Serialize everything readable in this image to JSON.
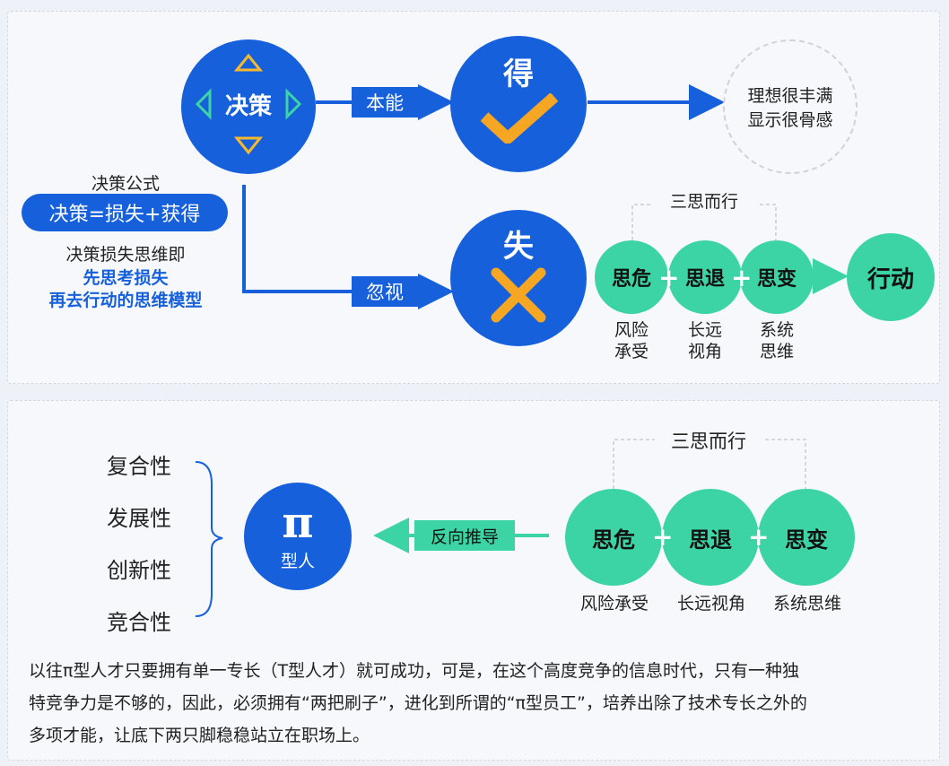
{
  "top": {
    "decision_label": "决策",
    "instinct_label": "本能",
    "gain_label": "得",
    "ideal_line1": "理想很丰满",
    "ideal_line2": "显示很骨感",
    "formula_title": "决策公式",
    "formula": "决策=损失+获得",
    "mindset_line": "决策损失思维即",
    "model_line1": "先思考损失",
    "model_line2": "再去行动的思维模型",
    "ignore_label": "忽视",
    "loss_label": "失",
    "think_thrice": "三思而行",
    "think_danger": "思危",
    "think_retreat": "思退",
    "think_change": "思变",
    "action": "行动",
    "sub_risk_1": "风险",
    "sub_risk_2": "承受",
    "sub_long_1": "长远",
    "sub_long_2": "视角",
    "sub_sys_1": "系统",
    "sub_sys_2": "思维"
  },
  "bottom": {
    "traits": [
      "复合性",
      "发展性",
      "创新性",
      "竞合性"
    ],
    "pi_symbol": "π",
    "pi_type": "型人",
    "reverse_label": "反向推导",
    "think_thrice": "三思而行",
    "think_danger": "思危",
    "think_retreat": "思退",
    "think_change": "思变",
    "sub_risk": "风险承受",
    "sub_long": "长远视角",
    "sub_sys": "系统思维",
    "paragraph_line1": "以往π型人才只要拥有单一专长（T型人才）就可成功，可是，在这个高度竞争的信息时代，只有一种独",
    "paragraph_line2": "特竞争力是不够的，因此，必须拥有“两把刷子”，进化到所谓的“π型员工”，培养出除了技术专长之外的",
    "paragraph_line3": "多项才能，让底下两只脚稳稳站立在职场上。"
  },
  "colors": {
    "blue": "#1760dc",
    "green": "#3dd4a5",
    "check": "#f5a623"
  }
}
